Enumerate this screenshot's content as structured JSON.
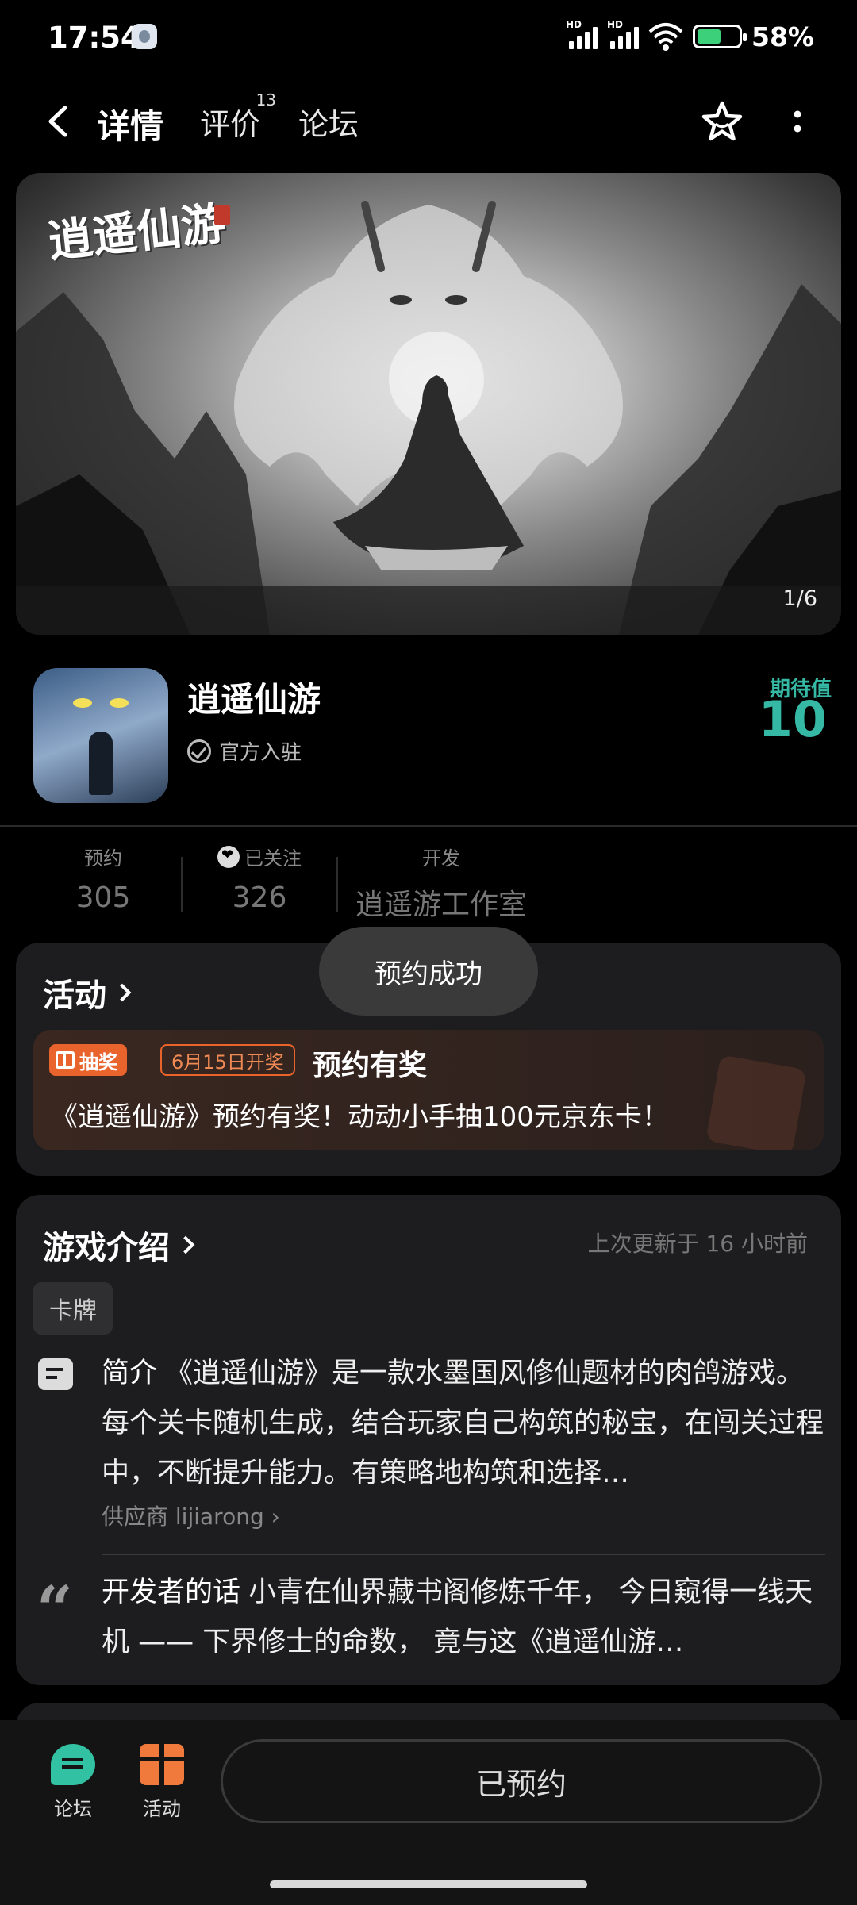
{
  "status_bar": {
    "time": "17:54",
    "battery_percent": "58%",
    "battery_level": 0.58,
    "network_label": "HD"
  },
  "nav": {
    "tabs": [
      {
        "label": "详情",
        "active": true
      },
      {
        "label": "评价",
        "badge": "13"
      },
      {
        "label": "论坛"
      }
    ],
    "icons": [
      "back-arrow-icon",
      "star-icon",
      "more-vertical-icon"
    ]
  },
  "hero": {
    "logo_text": "逍遥仙游",
    "counter": "1/6"
  },
  "app": {
    "name": "逍遥仙游",
    "official_label": "官方入驻",
    "expectation_label": "期待值",
    "expectation_value": "10"
  },
  "stats": [
    {
      "label": "预约",
      "value": "305"
    },
    {
      "label": "已关注",
      "value": "326"
    },
    {
      "label": "开发",
      "value": "逍遥游工作室"
    }
  ],
  "toast": "预约成功",
  "activity": {
    "title": "活动",
    "badge": "抽奖",
    "date_badge": "6月15日开奖",
    "promo_title": "预约有奖",
    "promo_desc": "《逍遥仙游》预约有奖！动动小手抽100元京东卡！"
  },
  "intro": {
    "title": "游戏介绍",
    "updated": "上次更新于 16 小时前",
    "tag": "卡牌",
    "summary_label": "简介",
    "summary": "《逍遥仙游》是一款水墨国风修仙题材的肉鸽游戏。每个关卡随机生成，结合玩家自己构筑的秘宝，在闯关过程中，不断提升能力。有策略地构筑和选择…",
    "supplier": "供应商 lijiarong",
    "dev_label": "开发者的话",
    "dev_words": "小青在仙界藏书阁修炼千年， 今日窥得一线天机 —— 下界修士的命数， 竟与这《逍遥仙游…"
  },
  "bottom_bar": {
    "forum_label": "论坛",
    "activity_label": "活动",
    "reserve_button": "已预约"
  },
  "colors": {
    "accent": "#35b8a4",
    "orange": "#e8642c",
    "background": "#000000",
    "card": "#1d1d1f"
  }
}
